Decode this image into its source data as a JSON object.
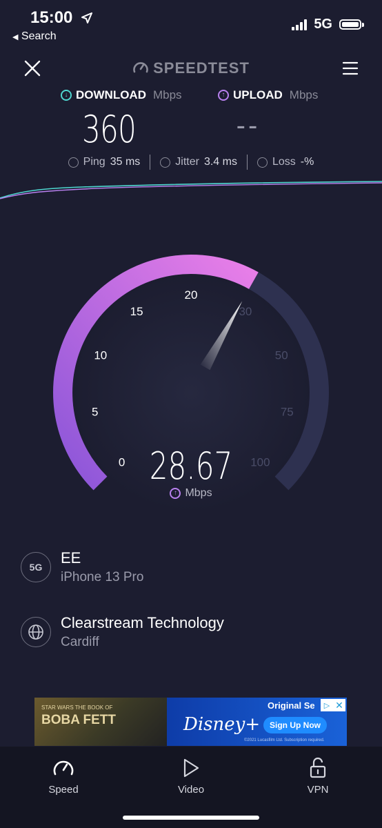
{
  "status_bar": {
    "time": "15:00",
    "back_label": "Search",
    "network": "5G"
  },
  "header": {
    "brand": "SPEEDTEST"
  },
  "metrics": {
    "download": {
      "label": "DOWNLOAD",
      "unit": "Mbps",
      "value": "360"
    },
    "upload": {
      "label": "UPLOAD",
      "unit": "Mbps",
      "value": "--"
    }
  },
  "stats": {
    "ping": {
      "label": "Ping",
      "value": "35 ms"
    },
    "jitter": {
      "label": "Jitter",
      "value": "3.4 ms"
    },
    "loss": {
      "label": "Loss",
      "value": "-%"
    }
  },
  "gauge": {
    "ticks": [
      "0",
      "5",
      "10",
      "15",
      "20",
      "30",
      "50",
      "75",
      "100"
    ],
    "current_value": "28.67",
    "current_number": 28.67,
    "unit": "Mbps",
    "fill_color_start": "#8a55d8",
    "fill_color_end": "#e97fe8",
    "track_color": "#2e3150"
  },
  "connection": {
    "carrier": {
      "icon_text": "5G",
      "title": "EE",
      "subtitle": "iPhone 13 Pro"
    },
    "server": {
      "title": "Clearstream Technology",
      "subtitle": "Cardiff"
    }
  },
  "ad": {
    "left_small": "STAR WARS THE BOOK OF",
    "left_title": "BOBA FETT",
    "brand": "Disney+",
    "headline": "Original Se",
    "cta": "Sign Up Now",
    "fine_print": "©2021 Lucasfilm Ltd. Subscription required."
  },
  "tabs": [
    {
      "label": "Speed",
      "icon": "speedometer-icon"
    },
    {
      "label": "Video",
      "icon": "play-icon"
    },
    {
      "label": "VPN",
      "icon": "lock-icon"
    }
  ],
  "colors": {
    "background": "#1c1d30",
    "download_accent": "#4fd6d0",
    "upload_accent": "#b981f0"
  }
}
